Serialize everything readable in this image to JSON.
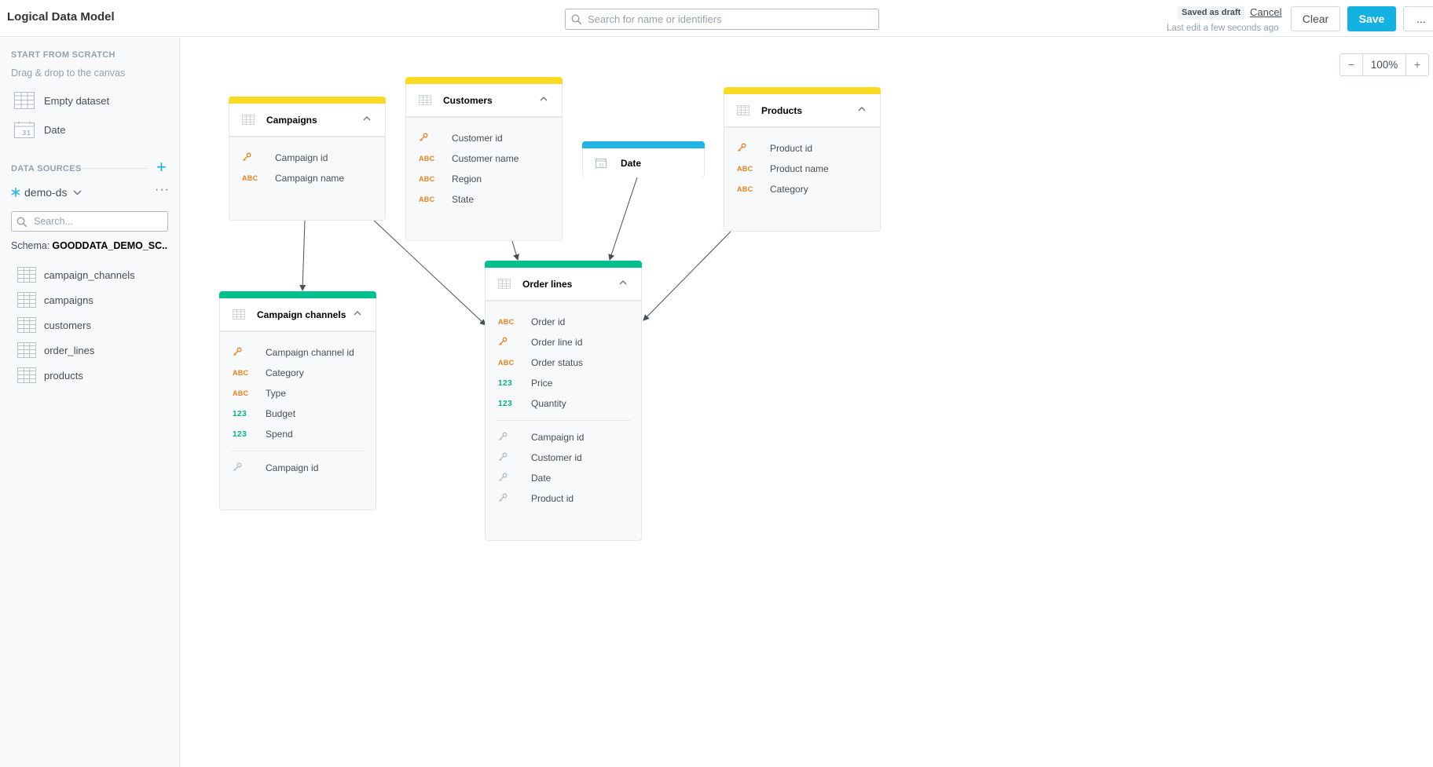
{
  "header": {
    "title": "Logical Data Model",
    "search_placeholder": "Search for name or identifiers",
    "draft_badge": "Saved as draft",
    "cancel_label": "Cancel",
    "last_edit": "Last edit a few seconds ago",
    "clear_label": "Clear",
    "save_label": "Save",
    "more_label": "..."
  },
  "sidebar": {
    "scratch_heading": "START FROM SCRATCH",
    "scratch_hint": "Drag & drop to the canvas",
    "scratch_items": [
      {
        "label": "Empty dataset",
        "icon": "table-icon"
      },
      {
        "label": "Date",
        "icon": "calendar-icon"
      }
    ],
    "sources_heading": "DATA SOURCES",
    "add_label": "+",
    "source_name": "demo-ds",
    "source_icon": "snowflake-icon",
    "search_placeholder": "Search...",
    "schema_label": "Schema:",
    "schema_value": "GOODDATA_DEMO_SC...",
    "tables": [
      "campaign_channels",
      "campaigns",
      "customers",
      "order_lines",
      "products"
    ]
  },
  "canvas": {
    "zoom_out": "−",
    "zoom_level": "100%",
    "zoom_in": "+"
  },
  "datasets": {
    "campaigns": {
      "title": "Campaigns",
      "fields": [
        {
          "type": "key",
          "label": "Campaign id"
        },
        {
          "type": "attr",
          "label": "Campaign name"
        }
      ]
    },
    "customers": {
      "title": "Customers",
      "fields": [
        {
          "type": "key",
          "label": "Customer id"
        },
        {
          "type": "attr",
          "label": "Customer name"
        },
        {
          "type": "attr",
          "label": "Region"
        },
        {
          "type": "attr",
          "label": "State"
        }
      ]
    },
    "date": {
      "title": "Date"
    },
    "products": {
      "title": "Products",
      "fields": [
        {
          "type": "key",
          "label": "Product id"
        },
        {
          "type": "attr",
          "label": "Product name"
        },
        {
          "type": "attr",
          "label": "Category"
        }
      ]
    },
    "campaign_channels": {
      "title": "Campaign channels",
      "fields": [
        {
          "type": "key",
          "label": "Campaign channel id"
        },
        {
          "type": "attr",
          "label": "Category"
        },
        {
          "type": "attr",
          "label": "Type"
        },
        {
          "type": "fact",
          "label": "Budget"
        },
        {
          "type": "fact",
          "label": "Spend"
        }
      ],
      "refs": [
        "Campaign id"
      ]
    },
    "order_lines": {
      "title": "Order lines",
      "fields": [
        {
          "type": "attr",
          "label": "Order id"
        },
        {
          "type": "key",
          "label": "Order line id"
        },
        {
          "type": "attr",
          "label": "Order status"
        },
        {
          "type": "fact",
          "label": "Price"
        },
        {
          "type": "fact",
          "label": "Quantity"
        }
      ],
      "refs": [
        "Campaign id",
        "Customer id",
        "Date",
        "Product id"
      ]
    }
  },
  "field_type_labels": {
    "attr": "ABC",
    "fact": "123"
  },
  "colors": {
    "accent": "#14b2e2",
    "dataset_bar": "#fada23",
    "fact_dataset_bar": "#00c18d",
    "date_dataset_bar": "#20b4e4",
    "attribute": "#e8801b",
    "fact": "#00b383"
  }
}
